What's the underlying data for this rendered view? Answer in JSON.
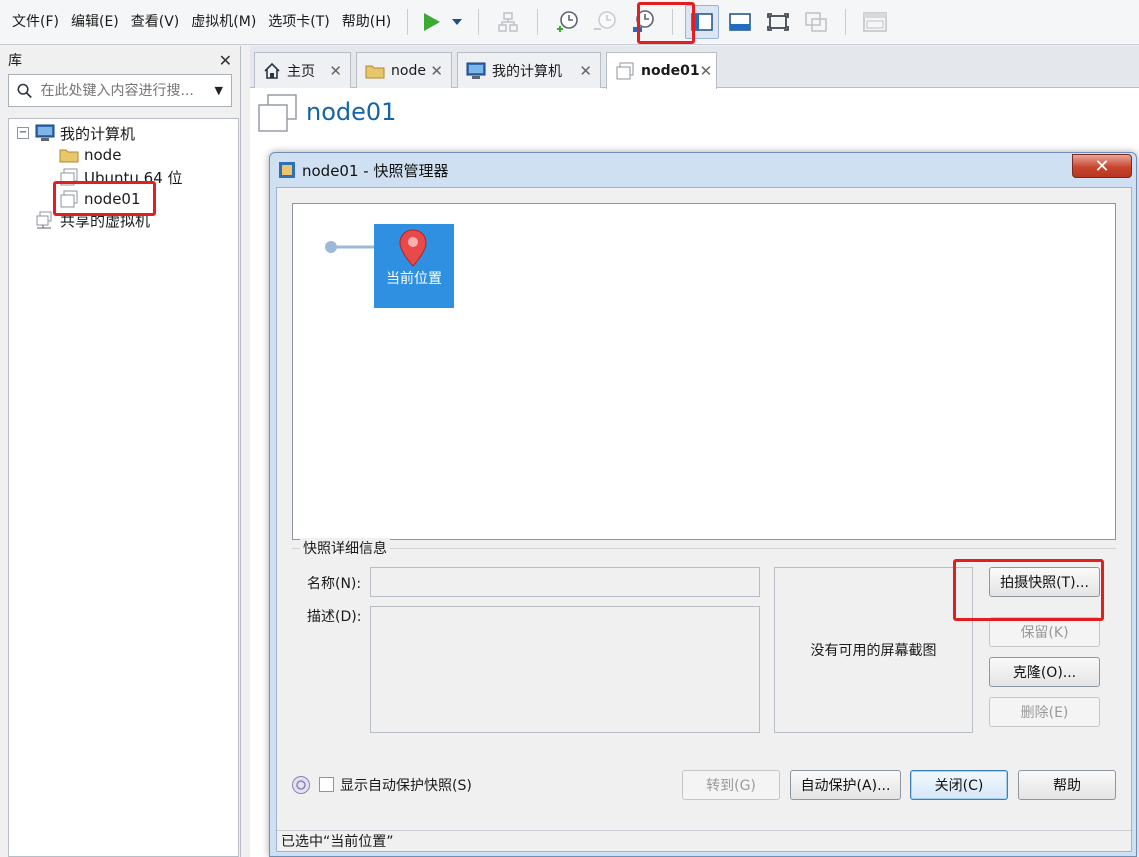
{
  "menubar": {
    "items": [
      "文件(F)",
      "编辑(E)",
      "查看(V)",
      "虚拟机(M)",
      "选项卡(T)",
      "帮助(H)"
    ]
  },
  "library": {
    "title": "库",
    "search_placeholder": "在此处键入内容进行搜...",
    "tree": [
      {
        "label": "我的计算机",
        "icon": "computer-icon"
      },
      {
        "label": "node",
        "icon": "folder-icon"
      },
      {
        "label": "Ubuntu 64 位",
        "icon": "vm-icon"
      },
      {
        "label": "node01",
        "icon": "vm-icon"
      },
      {
        "label": "共享的虚拟机",
        "icon": "shared-vm-icon"
      }
    ]
  },
  "tabs": [
    {
      "label": "主页",
      "icon": "home-icon"
    },
    {
      "label": "node",
      "icon": "folder-icon"
    },
    {
      "label": "我的计算机",
      "icon": "computer-icon"
    },
    {
      "label": "node01",
      "icon": "vm-icon",
      "active": true
    }
  ],
  "vm": {
    "title": "node01"
  },
  "dialog": {
    "title": "node01 - 快照管理器",
    "current_location": "当前位置",
    "details_legend": "快照详细信息",
    "name_label": "名称(N):",
    "desc_label": "描述(D):",
    "no_screenshot": "没有可用的屏幕截图",
    "buttons": {
      "take_snapshot": "拍摄快照(T)...",
      "keep": "保留(K)",
      "clone": "克隆(O)...",
      "delete": "删除(E)",
      "goto": "转到(G)",
      "autoprotect": "自动保护(A)...",
      "close": "关闭(C)",
      "help": "帮助"
    },
    "show_autoprotect": "显示自动保护快照(S)",
    "status": "已选中“当前位置”"
  },
  "colors": {
    "accent_blue": "#2f8fe0",
    "highlight_red": "#e41e1e",
    "title_blue": "#1565a6"
  }
}
